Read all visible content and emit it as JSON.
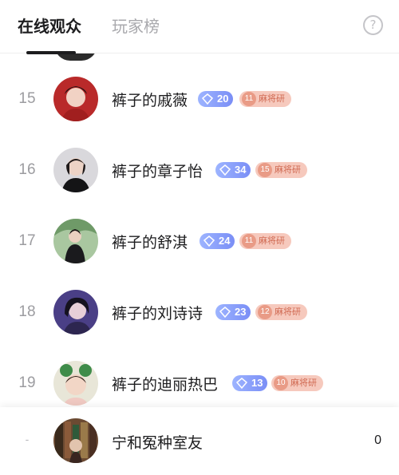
{
  "tabs": {
    "online_viewers": "在线观众",
    "leaderboard": "玩家榜"
  },
  "help_icon_glyph": "?",
  "rows": [
    {
      "rank": "15",
      "name": "裤子的戚薇",
      "level": "20",
      "fan_level": "11",
      "fan_club": "麻将研",
      "avatar_color": "#b92a2a"
    },
    {
      "rank": "16",
      "name": "裤子的章子怡",
      "level": "34",
      "fan_level": "15",
      "fan_club": "麻将研",
      "avatar_color": "#2a2a2e"
    },
    {
      "rank": "17",
      "name": "裤子的舒淇",
      "level": "24",
      "fan_level": "11",
      "fan_club": "麻将研",
      "avatar_color": "#7da57a"
    },
    {
      "rank": "18",
      "name": "裤子的刘诗诗",
      "level": "23",
      "fan_level": "12",
      "fan_club": "麻将研",
      "avatar_color": "#4a3f86"
    },
    {
      "rank": "19",
      "name": "裤子的迪丽热巴",
      "level": "13",
      "fan_level": "10",
      "fan_club": "麻将研",
      "avatar_color": "#3f8c4a"
    }
  ],
  "self": {
    "rank": "-",
    "name": "宁和冤种室友",
    "score": "0"
  },
  "colors": {
    "text_primary": "#1d1d1f",
    "text_muted": "#9c9ca0",
    "level_badge": "#7a8ef6",
    "fan_badge_bg": "#f6c9bd",
    "fan_badge_text": "#d06a52"
  }
}
